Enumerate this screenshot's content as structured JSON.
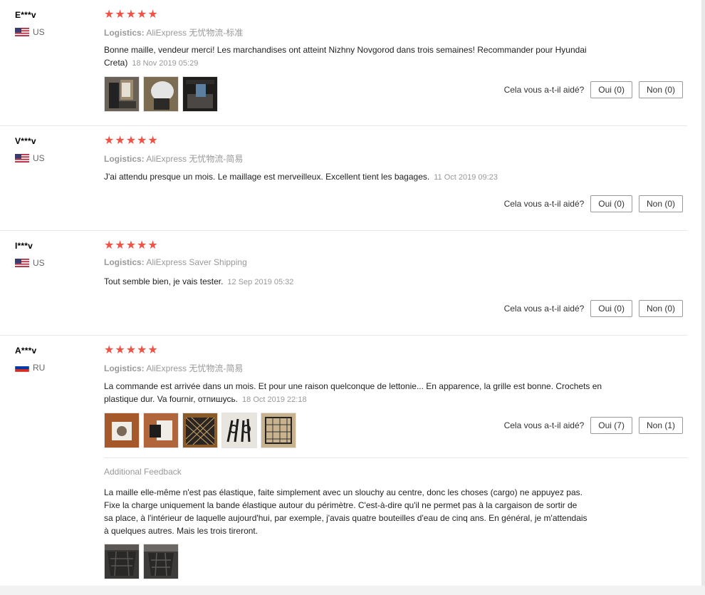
{
  "helpful_question": "Cela vous a-t-il aidé?",
  "logistics_label": "Logistics:",
  "reviews": [
    {
      "user": "E***v",
      "country": "US",
      "stars": 5,
      "logistics": "AliExpress 无忧物流-标准",
      "text": "Bonne maille, vendeur merci! Les marchandises ont atteint Nizhny Novgorod dans trois semaines! Recommander pour Hyundai Creta)",
      "date": "18 Nov 2019 05:29",
      "yes": "Oui (0)",
      "no": "Non (0)"
    },
    {
      "user": "V***v",
      "country": "US",
      "stars": 5,
      "logistics": "AliExpress 无忧物流-简易",
      "text": "J'ai attendu presque un mois. Le maillage est merveilleux. Excellent tient les bagages.",
      "date": "11 Oct 2019 09:23",
      "yes": "Oui (0)",
      "no": "Non (0)"
    },
    {
      "user": "I***v",
      "country": "US",
      "stars": 5,
      "logistics": "AliExpress Saver Shipping",
      "text": "Tout semble bien, je vais tester.",
      "date": "12 Sep 2019 05:32",
      "yes": "Oui (0)",
      "no": "Non (0)"
    },
    {
      "user": "A***v",
      "country": "RU",
      "stars": 5,
      "logistics": "AliExpress 无忧物流-简易",
      "text": "La commande est arrivée dans un mois. Et pour une raison quelconque de lettonie... En apparence, la grille est bonne. Crochets en plastique dur. Va fournir, отпишусь.",
      "date": "18 Oct 2019 22:18",
      "yes": "Oui (7)",
      "no": "Non (1)",
      "additional_title": "Additional Feedback",
      "additional_text": "La maille elle-même n'est pas élastique, faite simplement avec un slouchy au centre, donc les choses (cargo) ne appuyez pas. Fixe la charge uniquement la bande élastique autour du périmètre. C'est-à-dire qu'il ne permet pas à la cargaison de sortir de sa place, à l'intérieur de laquelle aujourd'hui, par exemple, j'avais quatre bouteilles d'eau de cinq ans. En général, je m'attendais à quelques autres. Mais les trois tireront."
    }
  ]
}
